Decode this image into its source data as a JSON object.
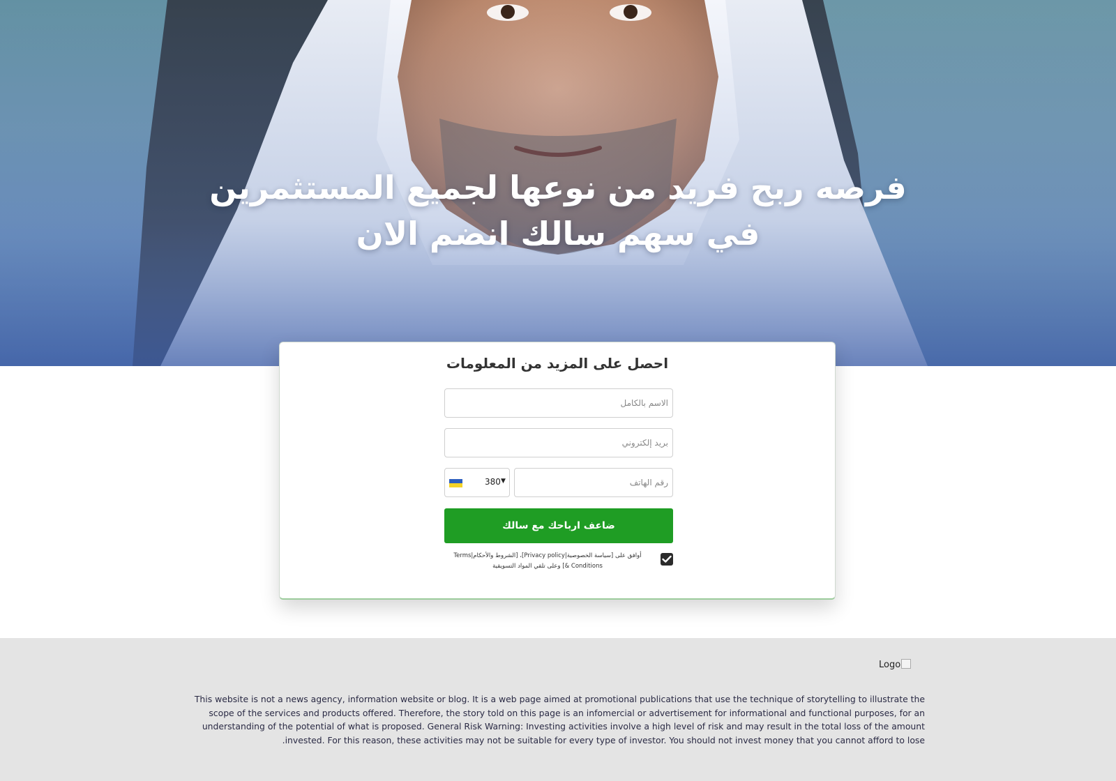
{
  "hero": {
    "title": "فرصه ربح فريد من نوعها لجميع المستثمرين في سهم سالك انضم الان"
  },
  "form": {
    "title": "احصل على المزيد من المعلومات",
    "name_placeholder": "الاسم بالكامل",
    "email_placeholder": "بريد إلكتروني",
    "phone_placeholder": "رقم الهاتف",
    "country_code": "380",
    "country_flag": "ukraine-flag-icon",
    "submit_label": "ضاعف ارباحك مع سالك",
    "consent_text": "أوافق على [سياسة الخصوصية|Privacy policy]، [الشروط والأحكام|Terms & Conditions] وعلى تلقي المواد التسويقية",
    "consent_checked": true
  },
  "footer": {
    "logo_alt": "Logo",
    "disclaimer": "This website is not a news agency, information website or blog. It is a web page aimed at promotional publications that use the technique of storytelling to illustrate the scope of the services and products offered. Therefore, the story told on this page is an infomercial or advertisement for informational and functional purposes, for an understanding of the potential of what is proposed. General Risk Warning: Investing activities involve a high level of risk and may result in the total loss of the amount invested. For this reason, these activities may not be suitable for every type of investor. You should not invest money that you cannot afford to lose."
  },
  "colors": {
    "accent_green": "#1f9d24",
    "hero_blue": "#4f6fb0",
    "footer_bg": "#e4e4e4"
  }
}
